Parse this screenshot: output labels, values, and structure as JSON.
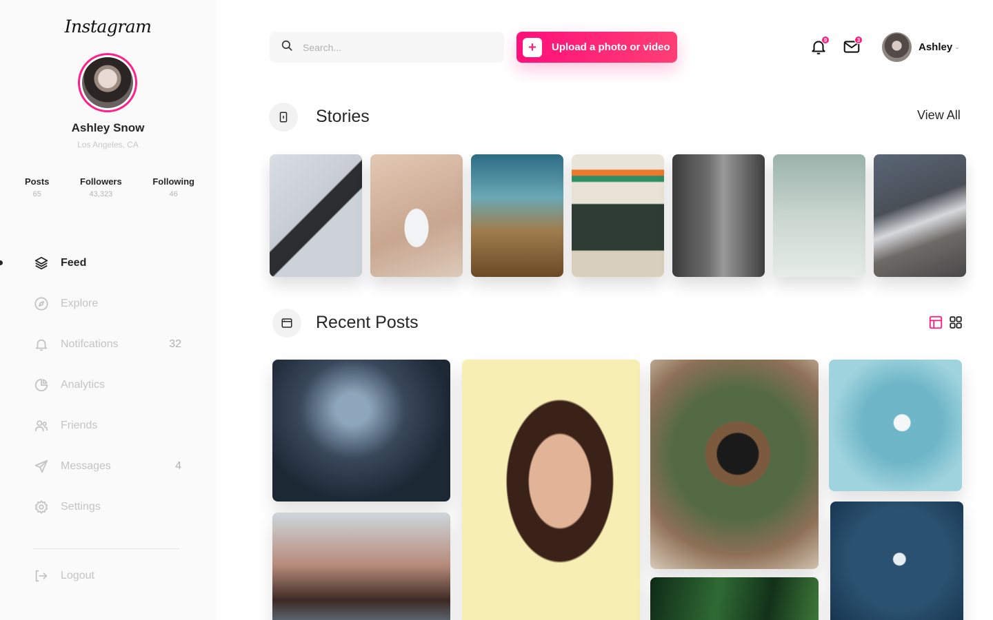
{
  "app": {
    "logo": "Instagram"
  },
  "profile": {
    "name": "Ashley Snow",
    "location": "Los Angeles, CA",
    "stats": [
      {
        "label": "Posts",
        "value": "65"
      },
      {
        "label": "Followers",
        "value": "43,323"
      },
      {
        "label": "Following",
        "value": "46"
      }
    ]
  },
  "nav": {
    "items": [
      {
        "label": "Feed",
        "icon": "layers-icon",
        "active": true
      },
      {
        "label": "Explore",
        "icon": "compass-icon"
      },
      {
        "label": "Notifcations",
        "icon": "bell-icon",
        "count": "32"
      },
      {
        "label": "Analytics",
        "icon": "pie-chart-icon"
      },
      {
        "label": "Friends",
        "icon": "users-icon"
      },
      {
        "label": "Messages",
        "icon": "send-icon",
        "count": "4"
      },
      {
        "label": "Settings",
        "icon": "gear-icon"
      }
    ],
    "logout": "Logout"
  },
  "topbar": {
    "search_placeholder": "Search...",
    "upload_label": "Upload a photo or video",
    "notifications_badge": "9",
    "messages_badge": "3",
    "user_name": "Ashley"
  },
  "stories": {
    "title": "Stories",
    "view_all": "View All",
    "items": [
      "polaroid-camera",
      "sand-body",
      "desert-cactus",
      "storefront",
      "woman-bw",
      "palm-trees",
      "sneakers"
    ]
  },
  "recent_posts": {
    "title": "Recent Posts",
    "items": [
      "skyscraper-fog",
      "woman-hair-wind",
      "woman-portrait",
      "camera-in-plants",
      "green-leaves",
      "boat-turquoise",
      "boat-dark-sea"
    ]
  },
  "colors": {
    "accent": "#ff1e7c",
    "sidebar_bg": "#fafafa",
    "text": "#262626",
    "muted": "#c4c4c4"
  }
}
